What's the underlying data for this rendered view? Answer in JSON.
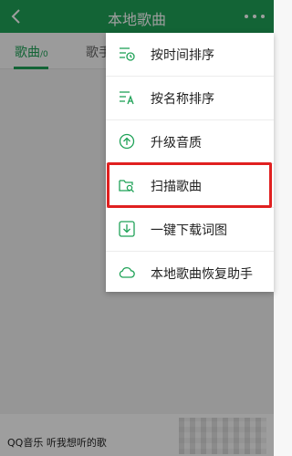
{
  "header": {
    "title": "本地歌曲"
  },
  "tabs": [
    {
      "label": "歌曲",
      "count": "/0"
    },
    {
      "label": "歌手"
    }
  ],
  "menu": {
    "items": [
      {
        "label": "按时间排序",
        "icon": "sort-by-time-icon"
      },
      {
        "label": "按名称排序",
        "icon": "sort-by-name-icon"
      },
      {
        "label": "升级音质",
        "icon": "upgrade-quality-icon"
      },
      {
        "label": "扫描歌曲",
        "icon": "scan-songs-icon"
      },
      {
        "label": "一键下载词图",
        "icon": "download-lyrics-icon"
      },
      {
        "label": "本地歌曲恢复助手",
        "icon": "cloud-restore-icon"
      }
    ]
  },
  "footer": {
    "text": "QQ音乐 听我想听的歌"
  },
  "colors": {
    "accent": "#1fa257",
    "highlight": "#e02020"
  }
}
